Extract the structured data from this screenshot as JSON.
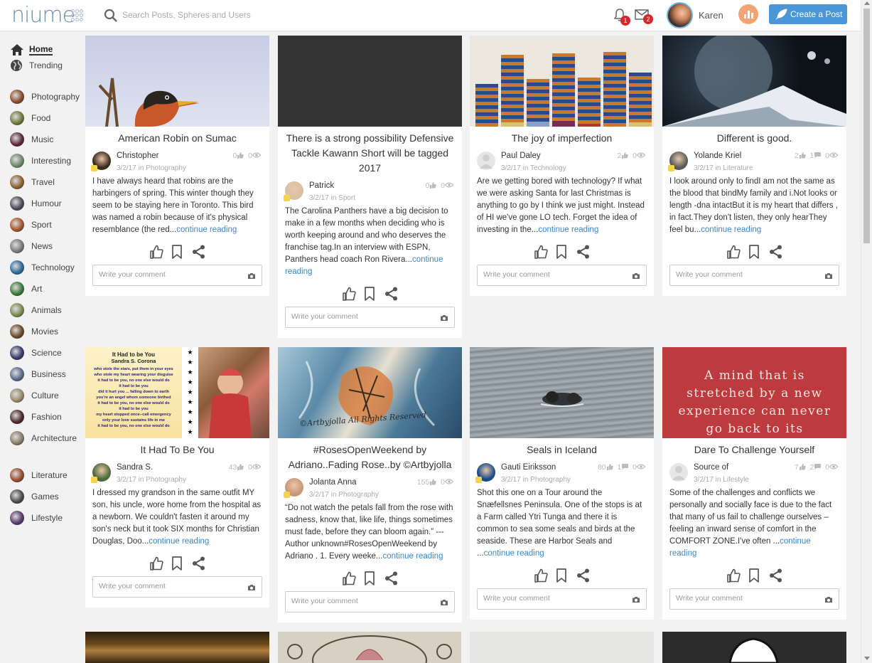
{
  "header": {
    "logo": "niume",
    "search_placeholder": "Search Posts, Spheres and Users",
    "notif_count": "1",
    "msg_count": "2",
    "user_name": "Karen",
    "create_label": "Create a Post"
  },
  "sidebar": {
    "top": [
      {
        "label": "Home",
        "icon": "home-icon"
      },
      {
        "label": "Trending",
        "icon": "globe-icon"
      }
    ],
    "spheres": [
      {
        "label": "Photography",
        "color": "#8a4a2c"
      },
      {
        "label": "Food",
        "color": "#6e7a3a"
      },
      {
        "label": "Music",
        "color": "#5c2a3a"
      },
      {
        "label": "Interesting",
        "color": "#6d8a6a"
      },
      {
        "label": "Travel",
        "color": "#8a6232"
      },
      {
        "label": "Humour",
        "color": "#4a4a5a"
      },
      {
        "label": "Sport",
        "color": "#a4552c"
      },
      {
        "label": "News",
        "color": "#7a7a7a"
      },
      {
        "label": "Technology",
        "color": "#2c6a9a"
      },
      {
        "label": "Art",
        "color": "#3a7a3a"
      },
      {
        "label": "Animals",
        "color": "#7a8a4a"
      },
      {
        "label": "Movies",
        "color": "#6a4a2a"
      },
      {
        "label": "Science",
        "color": "#3a3a6a"
      },
      {
        "label": "Business",
        "color": "#5a6a8a"
      },
      {
        "label": "Culture",
        "color": "#9a8a6a"
      },
      {
        "label": "Fashion",
        "color": "#4a2a2a"
      },
      {
        "label": "Architecture",
        "color": "#8a7a6a"
      }
    ],
    "extra": [
      {
        "label": "Literature",
        "color": "#9a4a2a"
      },
      {
        "label": "Games",
        "color": "#4a4a4a"
      },
      {
        "label": "Lifestyle",
        "color": "#5a3a6a"
      }
    ]
  },
  "comment_placeholder": "Write your comment",
  "posts": [
    {
      "title": "American Robin on Sumac",
      "author": "Christopher",
      "date": "3/2/17",
      "in": "in",
      "sphere": "Photography",
      "likes": "0",
      "comments": "",
      "views": "0",
      "excerpt": "I have always heard that robins are the harbingers of spring. This winter though they seem to be staying here in Toronto. This bird was named a robin because of it's physical resemblance (the red...",
      "more": "continue reading"
    },
    {
      "title": "There is a strong possibility Defensive Tackle Kawann Short will be tagged 2017",
      "author": "Patrick",
      "date": "3/2/17",
      "in": "in",
      "sphere": "Sport",
      "likes": "0",
      "comments": "",
      "views": "0",
      "excerpt": "The Carolina Panthers have a big decision to make in a few months when deciding who is worth keeping around and who deserves the franchise tag.In an interview with ESPN, Panthers head coach Ron Rivera...",
      "more": "continue reading"
    },
    {
      "title": "The joy of imperfection",
      "author": "Paul Daley",
      "date": "3/2/17",
      "in": "in",
      "sphere": "Technology",
      "likes": "2",
      "comments": "",
      "views": "0",
      "excerpt": "Are we getting bored with technology? If what we were asking Santa for last Christmas is anything to go by I think we just might. Instead of HI we've gone LO tech. Forget the idea of investing in the...",
      "more": "continue reading"
    },
    {
      "title": "Different is good.",
      "author": "Yolande Kriel",
      "date": "3/2/17",
      "in": "in",
      "sphere": "Literature",
      "likes": "2",
      "comments": "1",
      "views": "0",
      "excerpt": "I look around only to findI am not the same as the blood that bindMy family and i.Not looks or length -dna intactBut it is my heart that differs , in fact.They don't listen, they only hearThey feel bu...",
      "more": "continue reading"
    },
    {
      "title": "It Had To Be You",
      "author": "Sandra S.",
      "date": "3/2/17",
      "in": "in",
      "sphere": "Photography",
      "likes": "43",
      "comments": "",
      "views": "0",
      "excerpt": "I dressed my grandson in the same outfit MY son, his uncle, wore home from the hospital as a newborn.  We couldn't fasten it around my son's neck but it took SIX months for Christian Douglas, Doo...",
      "more": "continue reading"
    },
    {
      "title": "#RosesOpenWeekend by Adriano..Fading Rose..by ©Artbyjolla",
      "author": "Jolanta Anna",
      "date": "3/2/17",
      "in": "in",
      "sphere": "Photography",
      "likes": "155",
      "comments": "",
      "views": "0",
      "excerpt": "“Do not watch the petals fall from the rose with sadness, know that, like life, things sometimes must fade, before they can bloom again.” --- Author unknown#RosesOpenWeekend by Adriano . 1. Every weeke...",
      "more": "continue reading"
    },
    {
      "title": "Seals in Iceland",
      "author": "Gauti Eiriksson",
      "date": "3/2/17",
      "in": "in",
      "sphere": "Photography",
      "likes": "80",
      "comments": "1",
      "views": "0",
      "excerpt": "Shot this one on a Tour around the Snæfellsnes Peninsula. One of the stops is at a Farm called Ytri Tunga and there it is common to sea some seals and birds at the seaside. These are Harbor Seals and ...",
      "more": "continue reading"
    },
    {
      "title": "Dare To Challenge Yourself",
      "author": "Source of",
      "date": "3/2/17",
      "in": "in",
      "sphere": "Lifestyle",
      "likes": "7",
      "comments": "2",
      "views": "0",
      "excerpt": "Some of the challenges and conflicts we personally and socially face is due to the fact that many of us fail to challenge ourselves – feeling an inward sense of comfort in the COMFORT ZONE.I've often ...",
      "more": "continue reading"
    }
  ],
  "images": {
    "poem_title": "It Had to be You",
    "poem_author": "Sandra S. Corona",
    "poem_lines": [
      "who stole the stars, put them in your eyes",
      "who stole my heart wearing your disguise",
      "it had to be you, no one else would do",
      "it had to be you",
      "did it hurt you ... falling down to earth",
      "you're an angel whom someone birthed",
      "it had to be you, no one else would do",
      "it had to be you",
      "my heart stopped once--call emergency",
      "only your love sustains life in me",
      "it had to be you, no one else would do"
    ],
    "rose_watermark": "©Artbyjolla All Rights Reserved",
    "quote": "A mind that is stretched by a new experience can never go back to its"
  }
}
